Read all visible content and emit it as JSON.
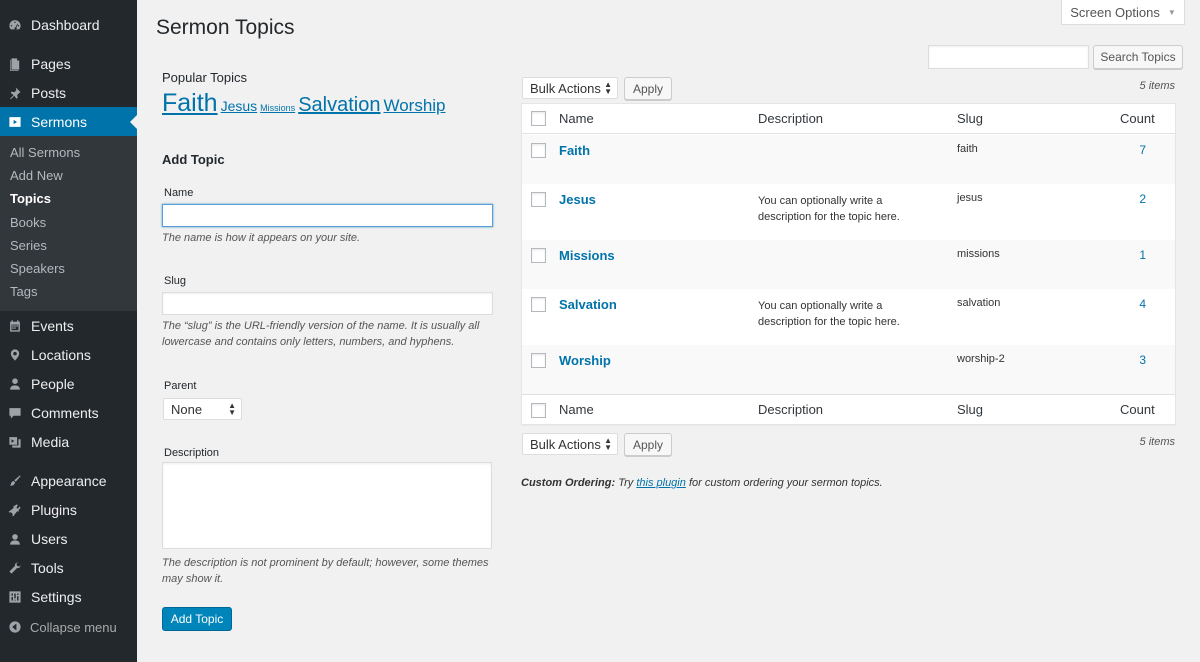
{
  "sidebar": {
    "items": [
      {
        "label": "Dashboard",
        "icon": "dashboard-icon"
      },
      {
        "label": "Pages",
        "icon": "pages-icon"
      },
      {
        "label": "Posts",
        "icon": "pin-icon"
      },
      {
        "label": "Sermons",
        "icon": "video-play-icon"
      },
      {
        "label": "Events",
        "icon": "calendar-icon"
      },
      {
        "label": "Locations",
        "icon": "location-pin-icon"
      },
      {
        "label": "People",
        "icon": "person-icon"
      },
      {
        "label": "Comments",
        "icon": "comment-icon"
      },
      {
        "label": "Media",
        "icon": "media-icon"
      },
      {
        "label": "Appearance",
        "icon": "brush-icon"
      },
      {
        "label": "Plugins",
        "icon": "plug-icon"
      },
      {
        "label": "Users",
        "icon": "users-icon"
      },
      {
        "label": "Tools",
        "icon": "wrench-icon"
      },
      {
        "label": "Settings",
        "icon": "sliders-icon"
      }
    ],
    "submenu": [
      "All Sermons",
      "Add New",
      "Topics",
      "Books",
      "Series",
      "Speakers",
      "Tags"
    ],
    "current_sub": "Topics",
    "collapse_label": "Collapse menu"
  },
  "header": {
    "title": "Sermon Topics",
    "screen_options": "Screen Options",
    "search_button": "Search Topics",
    "search_value": ""
  },
  "popular": {
    "heading": "Popular Topics",
    "tags": [
      {
        "label": "Faith",
        "size": "large"
      },
      {
        "label": "Jesus",
        "size": "medium"
      },
      {
        "label": "Missions",
        "size": "small"
      },
      {
        "label": "Salvation",
        "size": "large"
      },
      {
        "label": "Worship",
        "size": "medium"
      }
    ]
  },
  "form": {
    "heading": "Add Topic",
    "name_label": "Name",
    "name_value": "",
    "name_help": "The name is how it appears on your site.",
    "slug_label": "Slug",
    "slug_value": "",
    "slug_help": "The “slug” is the URL-friendly version of the name. It is usually all lowercase and contains only letters, numbers, and hyphens.",
    "parent_label": "Parent",
    "parent_value": "None",
    "description_label": "Description",
    "description_value": "",
    "description_help": "The description is not prominent by default; however, some themes may show it.",
    "submit_label": "Add Topic"
  },
  "table": {
    "bulk_actions": "Bulk Actions",
    "apply": "Apply",
    "items_count": "5 items",
    "columns": [
      "Name",
      "Description",
      "Slug",
      "Count"
    ],
    "rows": [
      {
        "name": "Faith",
        "description": "",
        "slug": "faith",
        "count": "7"
      },
      {
        "name": "Jesus",
        "description": "You can optionally write a description for the topic here.",
        "slug": "jesus",
        "count": "2"
      },
      {
        "name": "Missions",
        "description": "",
        "slug": "missions",
        "count": "1"
      },
      {
        "name": "Salvation",
        "description": "You can optionally write a description for the topic here.",
        "slug": "salvation",
        "count": "4"
      },
      {
        "name": "Worship",
        "description": "",
        "slug": "worship-2",
        "count": "3"
      }
    ]
  },
  "footer_note": {
    "label": "Custom Ordering:",
    "pre": "Try",
    "link": "this plugin",
    "post": "for custom ordering your sermon topics."
  },
  "colors": {
    "sidebar_bg": "#23282d",
    "submenu_bg": "#32373c",
    "accent": "#0073aa",
    "primary_button": "#0085ba"
  }
}
